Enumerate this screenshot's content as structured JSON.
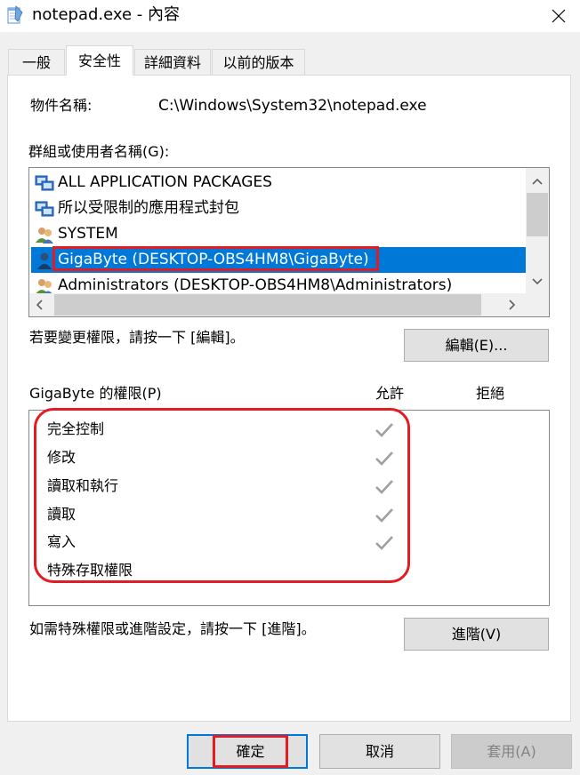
{
  "window": {
    "title": "notepad.exe - 內容",
    "accent": "#0078d7",
    "highlight_color": "#e31b23"
  },
  "tabs": [
    {
      "label": "一般",
      "active": false
    },
    {
      "label": "安全性",
      "active": true
    },
    {
      "label": "詳細資料",
      "active": false
    },
    {
      "label": "以前的版本",
      "active": false
    }
  ],
  "object": {
    "label": "物件名稱:",
    "value": "C:\\Windows\\System32\\notepad.exe"
  },
  "groups": {
    "label": "群組或使用者名稱(G):",
    "items": [
      {
        "name": "ALL APPLICATION PACKAGES",
        "icon": "package-group-icon",
        "selected": false
      },
      {
        "name": "所以受限制的應用程式封包",
        "icon": "package-group-icon",
        "selected": false
      },
      {
        "name": "SYSTEM",
        "icon": "users-group-icon",
        "selected": false
      },
      {
        "name": "GigaByte (DESKTOP-OBS4HM8\\GigaByte)",
        "icon": "user-icon",
        "selected": true
      },
      {
        "name": "Administrators (DESKTOP-OBS4HM8\\Administrators)",
        "icon": "users-group-icon",
        "selected": false
      }
    ]
  },
  "edit": {
    "hint": "若要變更權限，請按一下 [編輯]。",
    "button": "編輯(E)..."
  },
  "permissions": {
    "label": "GigaByte 的權限(P)",
    "allow_header": "允許",
    "deny_header": "拒絕",
    "items": [
      {
        "name": "完全控制",
        "allow": true,
        "deny": false
      },
      {
        "name": "修改",
        "allow": true,
        "deny": false
      },
      {
        "name": "讀取和執行",
        "allow": true,
        "deny": false
      },
      {
        "name": "讀取",
        "allow": true,
        "deny": false
      },
      {
        "name": "寫入",
        "allow": true,
        "deny": false
      },
      {
        "name": "特殊存取權限",
        "allow": false,
        "deny": false
      }
    ]
  },
  "advanced": {
    "hint": "如需特殊權限或進階設定，請按一下 [進階]。",
    "button": "進階(V)"
  },
  "footer": {
    "ok": "確定",
    "cancel": "取消",
    "apply": "套用(A)"
  }
}
